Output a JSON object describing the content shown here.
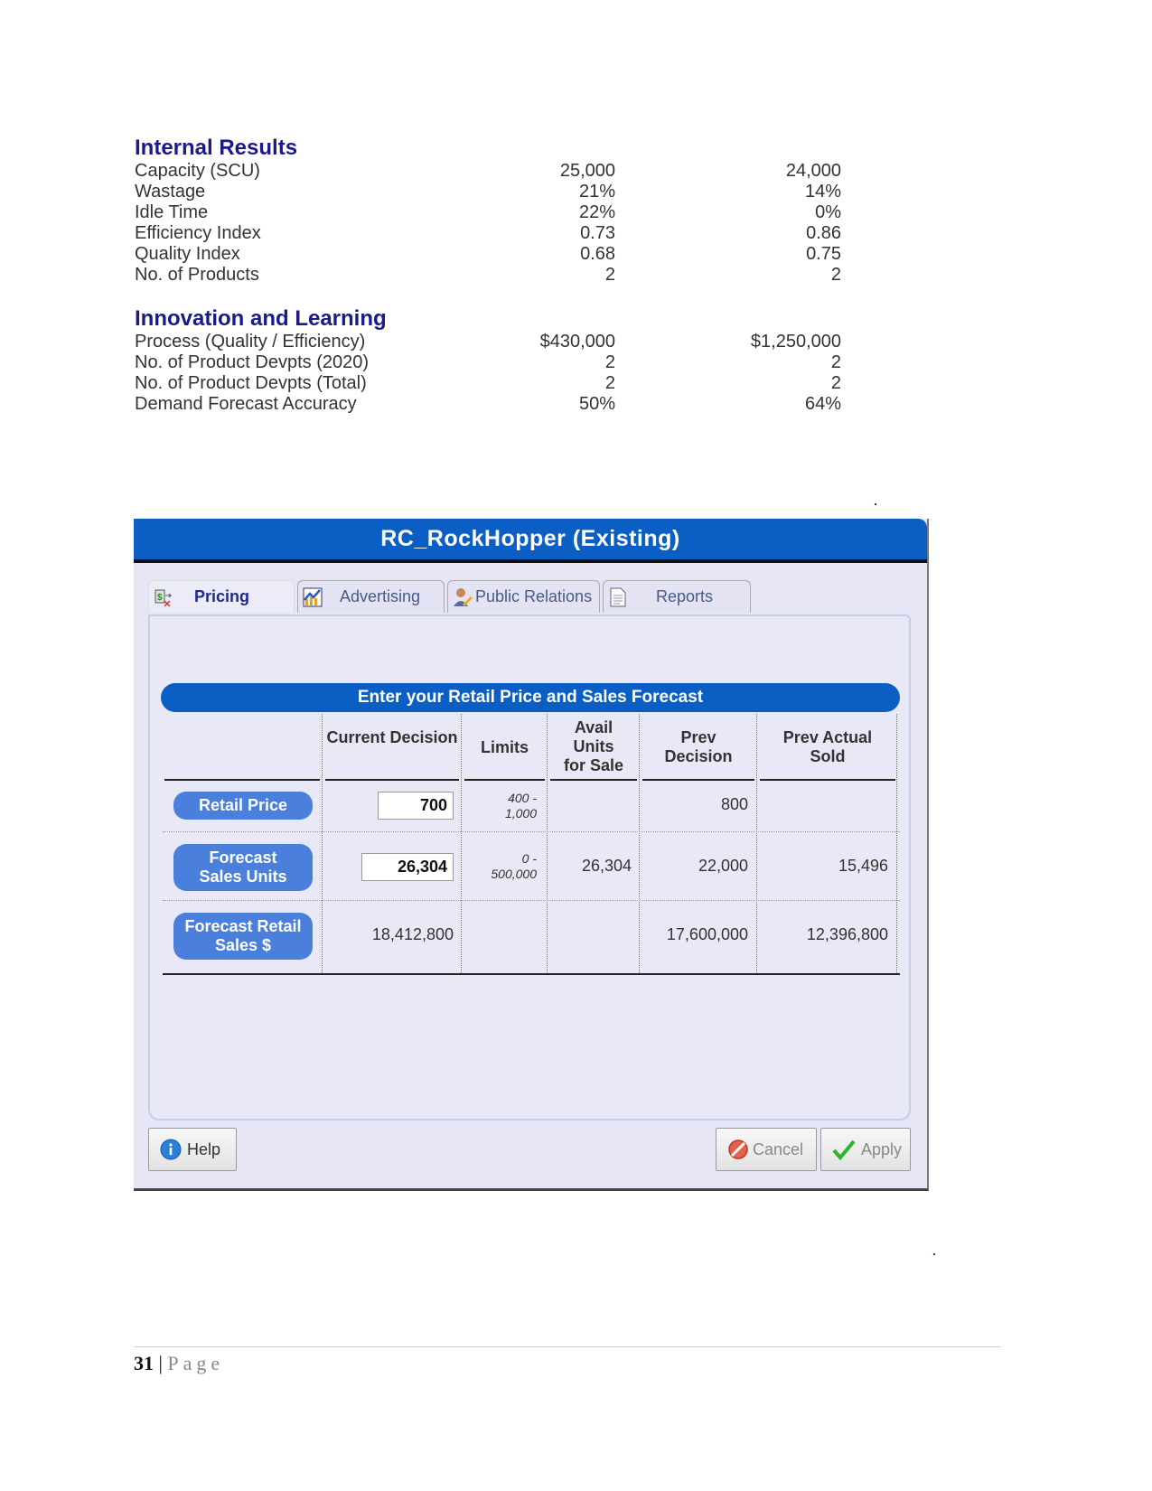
{
  "internal_results": {
    "title": "Internal Results",
    "rows": [
      {
        "label": "Capacity (SCU)",
        "v1": "25,000",
        "v2": "24,000"
      },
      {
        "label": "Wastage",
        "v1": "21%",
        "v2": "14%"
      },
      {
        "label": "Idle Time",
        "v1": "22%",
        "v2": "0%"
      },
      {
        "label": "Efficiency Index",
        "v1": "0.73",
        "v2": "0.86"
      },
      {
        "label": "Quality Index",
        "v1": "0.68",
        "v2": "0.75"
      },
      {
        "label": "No. of Products",
        "v1": "2",
        "v2": "2"
      }
    ]
  },
  "innovation": {
    "title": "Innovation and Learning",
    "rows": [
      {
        "label": "Process (Quality / Efficiency)",
        "v1": "$430,000",
        "v2": "$1,250,000"
      },
      {
        "label": "No. of Product Devpts (2020)",
        "v1": "2",
        "v2": "2"
      },
      {
        "label": "No. of Product Devpts (Total)",
        "v1": "2",
        "v2": "2"
      },
      {
        "label": "Demand Forecast Accuracy",
        "v1": "50%",
        "v2": "64%"
      }
    ]
  },
  "dialog": {
    "title": "RC_RockHopper (Existing)",
    "tabs": [
      {
        "label": "Pricing",
        "icon": "pricing-icon",
        "active": true
      },
      {
        "label": "Advertising",
        "icon": "chart-icon",
        "active": false
      },
      {
        "label": "Public Relations",
        "icon": "person-pen-icon",
        "active": false
      },
      {
        "label": "Reports",
        "icon": "document-icon",
        "active": false
      }
    ],
    "form_title": "Enter your Retail Price and Sales Forecast",
    "columns": {
      "current": "Current Decision",
      "limits": "Limits",
      "avail": "Avail Units for Sale",
      "prev_decision": "Prev Decision",
      "prev_actual": "Prev Actual Sold"
    },
    "rows": [
      {
        "label": "Retail Price",
        "current": "700",
        "limits": [
          "400 -",
          "1,000"
        ],
        "avail": "",
        "prev_decision": "800",
        "prev_actual": ""
      },
      {
        "label": "Forecast Sales Units",
        "current": "26,304",
        "limits": [
          "0 -",
          "500,000"
        ],
        "avail": "26,304",
        "prev_decision": "22,000",
        "prev_actual": "15,496"
      },
      {
        "label": "Forecast Retail Sales $",
        "current": "18,412,800",
        "limits": [
          "",
          ""
        ],
        "avail": "",
        "prev_decision": "17,600,000",
        "prev_actual": "12,396,800"
      }
    ],
    "buttons": {
      "help": "Help",
      "cancel": "Cancel",
      "apply": "Apply"
    }
  },
  "footer": {
    "page_number": "31",
    "separator": "|",
    "page_label": "Page"
  }
}
